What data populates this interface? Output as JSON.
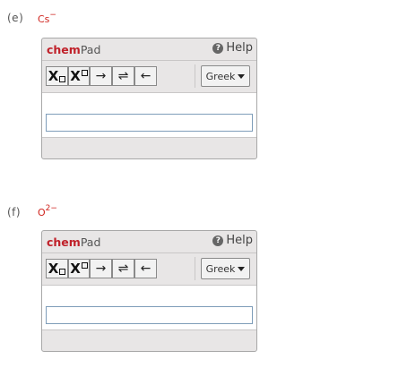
{
  "questions": [
    {
      "label": "(e)",
      "formula_base": "Cs",
      "formula_sup": "−",
      "chempad": {
        "brand_prefix": "chem",
        "brand_suffix": "Pad",
        "help_label": "Help",
        "toolbar": {
          "subscript_label": "X",
          "superscript_label": "X",
          "right_arrow": "→",
          "equilibrium_arrow": "⇌",
          "left_arrow": "←",
          "greek_label": "Greek"
        },
        "input_value": ""
      }
    },
    {
      "label": "(f)",
      "formula_base": "O",
      "formula_sup": "2−",
      "chempad": {
        "brand_prefix": "chem",
        "brand_suffix": "Pad",
        "help_label": "Help",
        "toolbar": {
          "subscript_label": "X",
          "superscript_label": "X",
          "right_arrow": "→",
          "equilibrium_arrow": "⇌",
          "left_arrow": "←",
          "greek_label": "Greek"
        },
        "input_value": ""
      }
    }
  ],
  "colors": {
    "formula": "#d0251f",
    "brand_accent": "#c0212a",
    "pad_background": "#e8e6e6",
    "input_border": "#7f9db9"
  },
  "icons": {
    "help": "help-circle-icon",
    "dropdown": "chevron-down-icon"
  }
}
